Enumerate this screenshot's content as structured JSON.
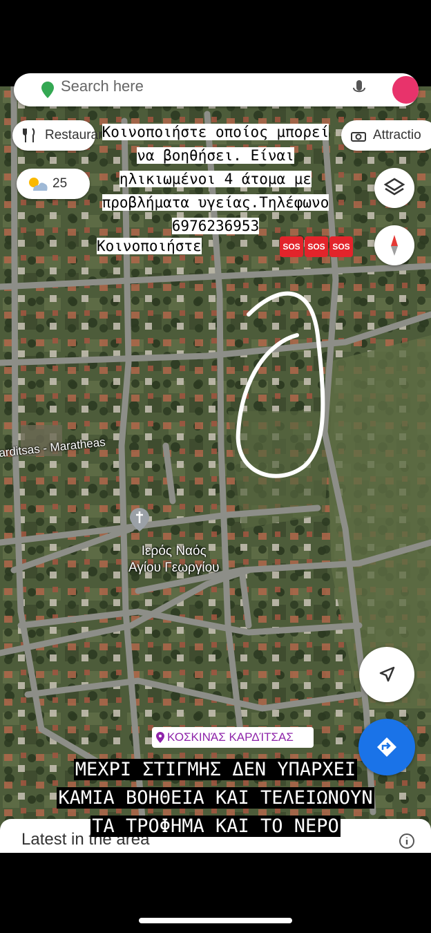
{
  "search": {
    "placeholder": "Search here"
  },
  "chips": {
    "restaurants": "Restaurants",
    "attractions": "Attractio",
    "weather_temp": "25"
  },
  "post_text": {
    "line1": "Κοινοποιήστε οποίος μπορεί",
    "line2": "να βοηθήσει. Είναι",
    "line3": "ηλικιωμένοι 4 άτομα με",
    "line4": "προβλήματα υγείας.Τηλέφωνο",
    "line5": "6976236953",
    "share": "Κοινοποιήστε",
    "sos": [
      "SOS",
      "SOS",
      "SOS"
    ],
    "bottom_line1": "ΜΕΧΡΙ ΣΤΙΓΜΗΣ ΔΕΝ ΥΠΑΡΧΕΙ",
    "bottom_line2": "ΚΑΜΙΑ ΒΟΗΘΕΙΑ ΚΑΙ ΤΕΛΕΙΩΝΟΥΝ",
    "bottom_line3": "ΤΑ ΤΡΟΦΗΜΑ ΚΑΙ ΤΟ ΝΕΡΟ"
  },
  "map_labels": {
    "road": "arditsas - Maratheas",
    "church_line1": "Ιερός Ναός",
    "church_line2": "Αγίου Γεωργίου",
    "region": "ΚΟΣΚΙΝΆΣ ΚΑΡΔΊΤΣΑΣ"
  },
  "bottom_sheet": {
    "title": "Latest in the area"
  },
  "colors": {
    "directions_button": "#1a73e8",
    "sos_badge": "#e3242b",
    "compass_red": "#e53935",
    "region_label": "#8e24aa"
  },
  "icons": [
    "map-pin-icon",
    "mic-icon",
    "restaurant-icon",
    "attraction-icon",
    "weather-icon",
    "layers-icon",
    "compass-icon",
    "navigation-arrow-icon",
    "directions-icon",
    "church-icon",
    "location-pin-icon",
    "info-icon"
  ]
}
